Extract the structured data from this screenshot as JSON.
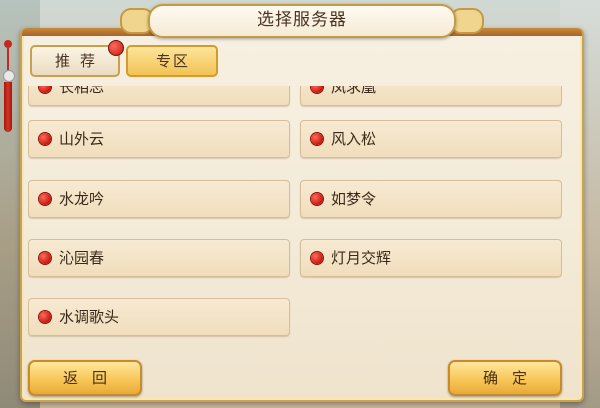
{
  "window": {
    "title": "选择服务器"
  },
  "tabs": {
    "recommend_label": "推荐",
    "zone_label": "专区",
    "active": "zone"
  },
  "servers": {
    "partial_left": "长相忘",
    "partial_right": "凤求凰",
    "rows": [
      {
        "left": "山外云",
        "right": "风入松"
      },
      {
        "left": "水龙吟",
        "right": "如梦令"
      },
      {
        "left": "沁园春",
        "right": "灯月交辉"
      },
      {
        "left": "水调歌头"
      }
    ],
    "status_color": "#d2281c"
  },
  "buttons": {
    "back_label": "返回",
    "confirm_label": "确定"
  },
  "colors": {
    "accent_gold": "#f3c255",
    "panel_bg": "#f3ead7",
    "border_gold": "#c9a24f"
  }
}
